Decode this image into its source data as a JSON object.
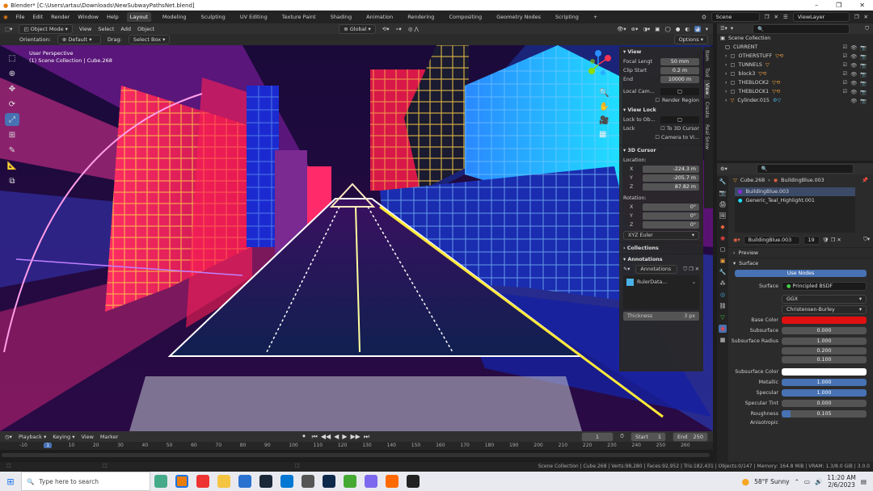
{
  "title": "Blender* [C:\\Users\\artau\\Downloads\\NewSubwayPathsNet.blend]",
  "window_ctrls": [
    "–",
    "❐",
    "✕"
  ],
  "menu": [
    "File",
    "Edit",
    "Render",
    "Window",
    "Help"
  ],
  "workspaces": [
    "Layout",
    "Modeling",
    "Sculpting",
    "UV Editing",
    "Texture Paint",
    "Shading",
    "Animation",
    "Rendering",
    "Compositing",
    "Geometry Nodes",
    "Scripting",
    "+"
  ],
  "scene": "Scene",
  "viewlayer": "ViewLayer",
  "header": {
    "mode": "Object Mode",
    "view": "View",
    "select": "Select",
    "add": "Add",
    "object": "Object",
    "orientation_label": "Orientation:",
    "orientation": "Default",
    "drag_label": "Drag:",
    "drag": "Select Box",
    "transform": "Global",
    "options": "Options"
  },
  "viewport": {
    "perspective": "User Perspective",
    "collection": "(1) Scene Collection | Cube.268"
  },
  "npanel": {
    "view_title": "View",
    "focal_label": "Focal Lengt",
    "focal": "50 mm",
    "clip_start_label": "Clip Start",
    "clip_start": "0.2 m",
    "end_label": "End",
    "end": "10000 m",
    "local_cam": "Local Cam...",
    "render_region": "Render Region",
    "view_lock": "View Lock",
    "lock_to_ob": "Lock to Ob...",
    "lock": "Lock",
    "to_3d_cursor": "To 3D Cursor",
    "camera_to_view": "Camera to Vi...",
    "cursor_title": "3D Cursor",
    "location": "Location:",
    "x_label": "X",
    "x": "-224.3 m",
    "y_label": "Y",
    "y": "-205.7 m",
    "z_label": "Z",
    "z": "87.82 m",
    "rotation": "Rotation:",
    "rx": "0°",
    "ry": "0°",
    "rz": "0°",
    "euler": "XYZ Euler",
    "collections": "Collections",
    "annotations_title": "Annotations",
    "annotations": "Annotations",
    "ruler": "RulerData...",
    "thickness_label": "Thickness",
    "thickness": "3 px",
    "tabs": [
      "Item",
      "Tool",
      "View",
      "Create",
      "Real Snow"
    ]
  },
  "outliner": {
    "root": "Scene Collection",
    "items": [
      "CURRENT",
      "OTHERSTUFF",
      "TUNNELS",
      "block3",
      "THEBLOCK2",
      "THEBLOCK1",
      "Cylinder.015"
    ]
  },
  "props": {
    "object": "Cube.268",
    "material": "BuildingBlue.003",
    "slots": [
      "BuildingBlue.003",
      "Generic_Teal_Highlight.001"
    ],
    "mat_name": "BuildingBlue.003",
    "users": "19",
    "preview": "Preview",
    "surface_section": "Surface",
    "use_nodes": "Use Nodes",
    "surface_label": "Surface",
    "surface": "Principled BSDF",
    "dist": "GGX",
    "sss_method": "Christensen-Burley",
    "base_color_label": "Base Color",
    "subsurface_label": "Subsurface",
    "subsurface": "0.000",
    "ss_radius_label": "Subsurface Radius",
    "ss_radius": [
      "1.000",
      "0.200",
      "0.100"
    ],
    "ss_color_label": "Subsurface Color",
    "metallic_label": "Metallic",
    "metallic": "1.000",
    "specular_label": "Specular",
    "specular": "1.000",
    "spec_tint_label": "Specular Tint",
    "spec_tint": "0.000",
    "roughness_label": "Roughness",
    "roughness": "0.105",
    "anisotropic_label": "Anisotropic"
  },
  "timeline": {
    "playback": "Playback",
    "keying": "Keying",
    "view": "View",
    "marker": "Marker",
    "current": "1",
    "start_label": "Start",
    "start": "1",
    "end_label": "End",
    "end": "250",
    "ticks": [
      "-10",
      "1",
      "10",
      "20",
      "30",
      "40",
      "50",
      "60",
      "70",
      "80",
      "90",
      "100",
      "110",
      "120",
      "130",
      "140",
      "150",
      "160",
      "170",
      "180",
      "190",
      "200",
      "210",
      "220",
      "230",
      "240",
      "250",
      "260"
    ]
  },
  "status": "Scene Collection | Cube.268 | Verts:98,280 | Faces:92,952 | Tris:182,431 | Objects:0/147 | Memory: 164.8 MiB | VRAM: 1.3/8.0 GiB | 3.0.0",
  "taskbar": {
    "search": "Type here to search",
    "weather": "58°F  Sunny",
    "time": "11:20 AM",
    "date": "2/6/2023"
  },
  "colors": {
    "accent": "#4772b3",
    "base_color": "#e01010",
    "subsurface_color": "#ffffff"
  }
}
